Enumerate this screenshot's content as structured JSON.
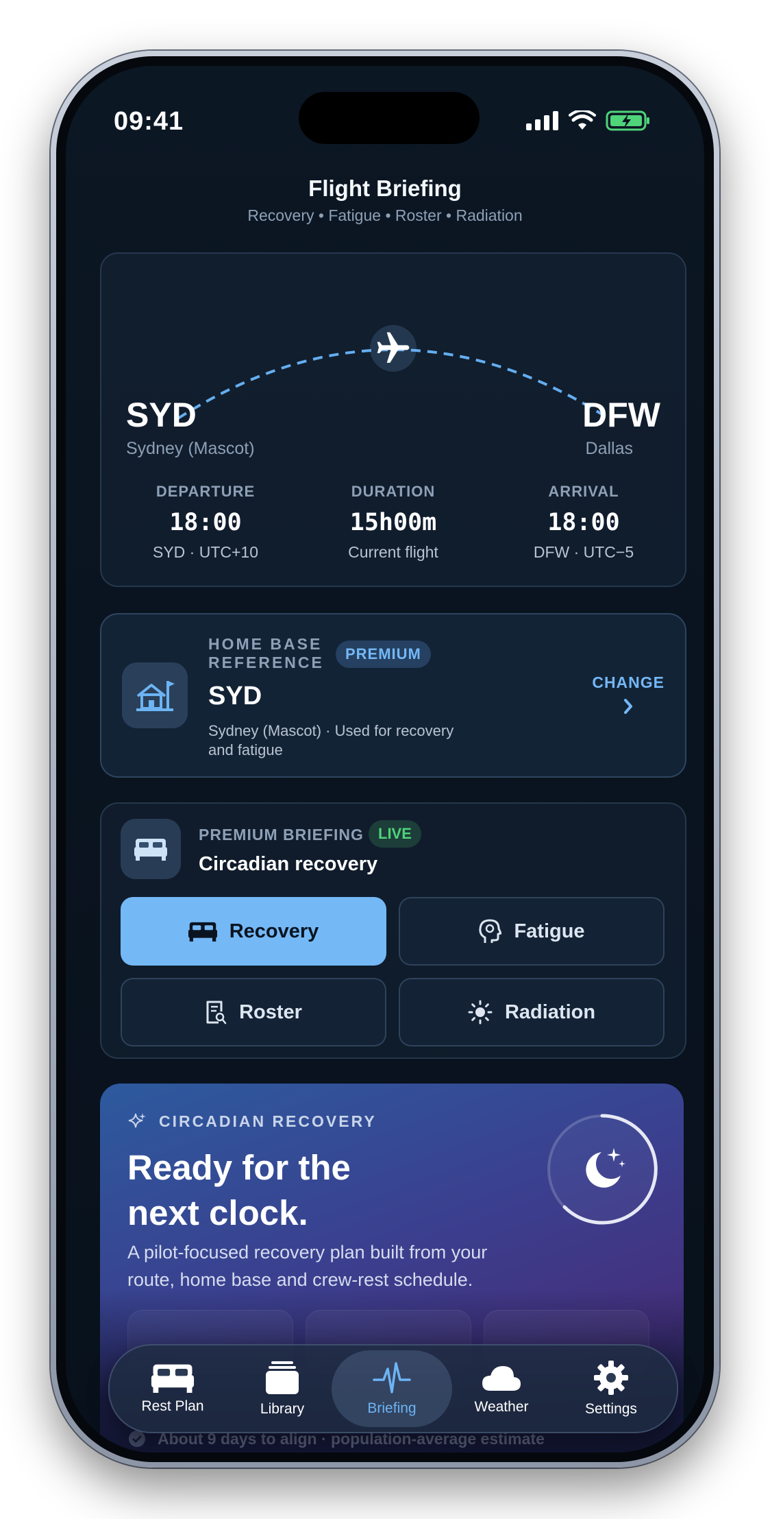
{
  "status": {
    "time": "09:41"
  },
  "header": {
    "title": "Flight Briefing",
    "subtitle": "Recovery • Fatigue • Roster • Radiation"
  },
  "route": {
    "origin": {
      "code": "SYD",
      "city": "Sydney (Mascot)"
    },
    "destination": {
      "code": "DFW",
      "city": "Dallas"
    },
    "departure": {
      "label": "DEPARTURE",
      "value": "18:00",
      "sub": "SYD · UTC+10"
    },
    "duration": {
      "label": "DURATION",
      "value": "15h00m",
      "sub": "Current flight"
    },
    "arrival": {
      "label": "ARRIVAL",
      "value": "18:00",
      "sub": "DFW · UTC−5"
    }
  },
  "home_base": {
    "kicker_line1": "HOME BASE",
    "kicker_line2": "REFERENCE",
    "badge": "PREMIUM",
    "code": "SYD",
    "desc_line1": "Sydney (Mascot) · Used for recovery",
    "desc_line2": "and fatigue",
    "action": "CHANGE"
  },
  "briefing": {
    "kicker": "PREMIUM BRIEFING",
    "badge": "LIVE",
    "title": "Circadian recovery",
    "modes": [
      {
        "label": "Recovery",
        "icon": "bed-icon",
        "active": true
      },
      {
        "label": "Fatigue",
        "icon": "brain-head-icon",
        "active": false
      },
      {
        "label": "Roster",
        "icon": "document-search-icon",
        "active": false
      },
      {
        "label": "Radiation",
        "icon": "sun-icon",
        "active": false
      }
    ]
  },
  "hero": {
    "kicker": "CIRCADIAN RECOVERY",
    "title_line1": "Ready for the",
    "title_line2": "next clock.",
    "body_line1": "A pilot-focused recovery plan built from your",
    "body_line2": "route, home base and crew-rest schedule.",
    "footer": "About 9 days to align · population-average estimate"
  },
  "tabbar": {
    "items": [
      {
        "label": "Rest Plan",
        "icon": "bed-icon"
      },
      {
        "label": "Library",
        "icon": "stack-icon"
      },
      {
        "label": "Briefing",
        "icon": "waveform-icon",
        "active": true
      },
      {
        "label": "Weather",
        "icon": "cloud-icon"
      },
      {
        "label": "Settings",
        "icon": "gear-icon"
      }
    ]
  },
  "colors": {
    "accent": "#74b8f6",
    "live": "#4fd47a",
    "background": "#0a1420"
  }
}
